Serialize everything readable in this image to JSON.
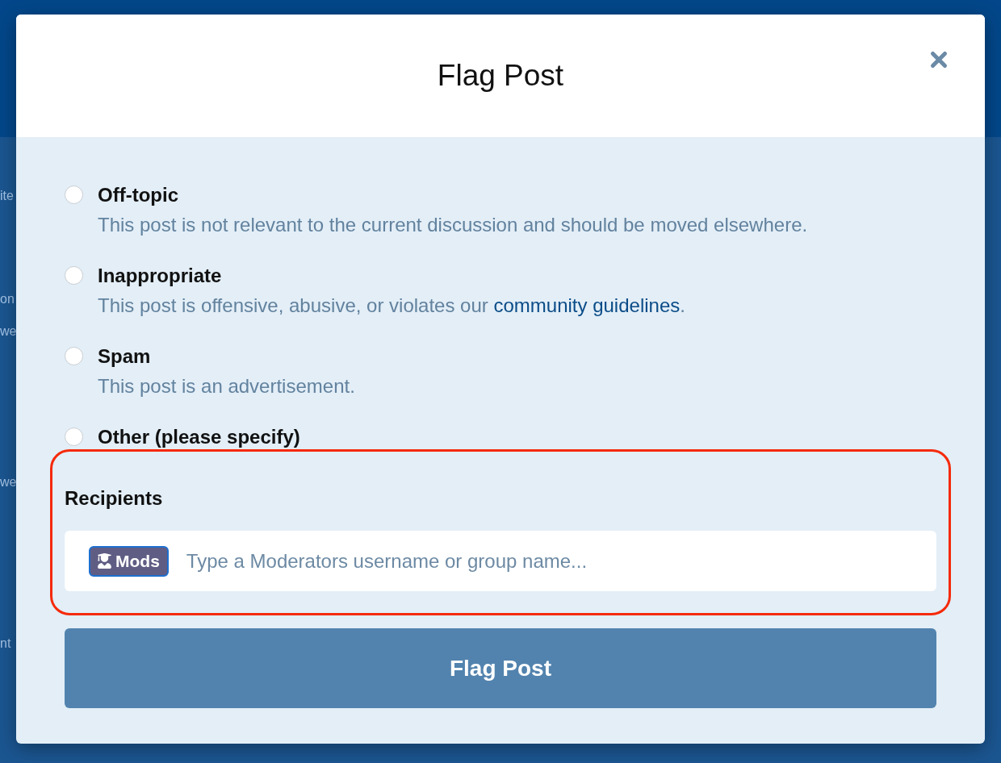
{
  "background": {
    "fragments": [
      "ite",
      "on",
      "we",
      "we",
      "nt"
    ]
  },
  "dialog": {
    "title": "Flag Post"
  },
  "options": [
    {
      "label": "Off-topic",
      "description": [
        {
          "kind": "text",
          "text": "This post is not relevant to the current discussion and should be moved elsewhere."
        }
      ],
      "selected": false
    },
    {
      "label": "Inappropriate",
      "description": [
        {
          "kind": "text",
          "text": "This post is offensive, abusive, or violates our "
        },
        {
          "kind": "link",
          "text": "community guidelines"
        },
        {
          "kind": "text",
          "text": "."
        }
      ],
      "selected": false
    },
    {
      "label": "Spam",
      "description": [
        {
          "kind": "text",
          "text": "This post is an advertisement."
        }
      ],
      "selected": false
    },
    {
      "label": "Other (please specify)",
      "selected": false
    }
  ],
  "recipients": {
    "label": "Recipients",
    "highlighted": true,
    "tokens": [
      {
        "label": "Mods"
      }
    ],
    "placeholder": "Type a Moderators username or group name..."
  },
  "submit": {
    "label": "Flag Post"
  }
}
